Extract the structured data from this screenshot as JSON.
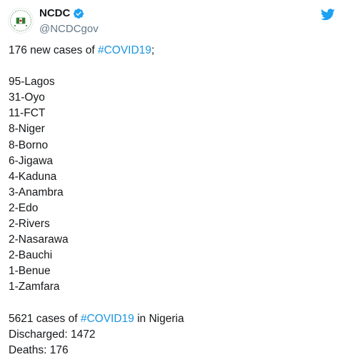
{
  "header": {
    "display_name": "NCDC",
    "handle": "@NCDCgov",
    "verified_icon": "verified-badge-icon",
    "platform_icon": "twitter-bird-icon"
  },
  "tweet": {
    "intro": {
      "prefix": "176 new cases of ",
      "hashtag": "#COVID19",
      "suffix": ";"
    },
    "states": [
      "95-Lagos",
      "31-Oyo",
      "11-FCT",
      "8-Niger",
      "8-Borno",
      "6-Jigawa",
      "4-Kaduna",
      "3-Anambra",
      "2-Edo",
      "2-Rivers",
      "2-Nasarawa",
      "2-Bauchi",
      "1-Benue",
      "1-Zamfara"
    ],
    "summary": {
      "prefix": "5621 cases of ",
      "hashtag": "#COVID19",
      "suffix": " in Nigeria",
      "discharged": "Discharged: 1472",
      "deaths": "Deaths: 176"
    }
  },
  "colors": {
    "hashtag": "#1b95e0",
    "verified": "#1da1f2",
    "handle": "#657786",
    "text": "#14171a"
  }
}
